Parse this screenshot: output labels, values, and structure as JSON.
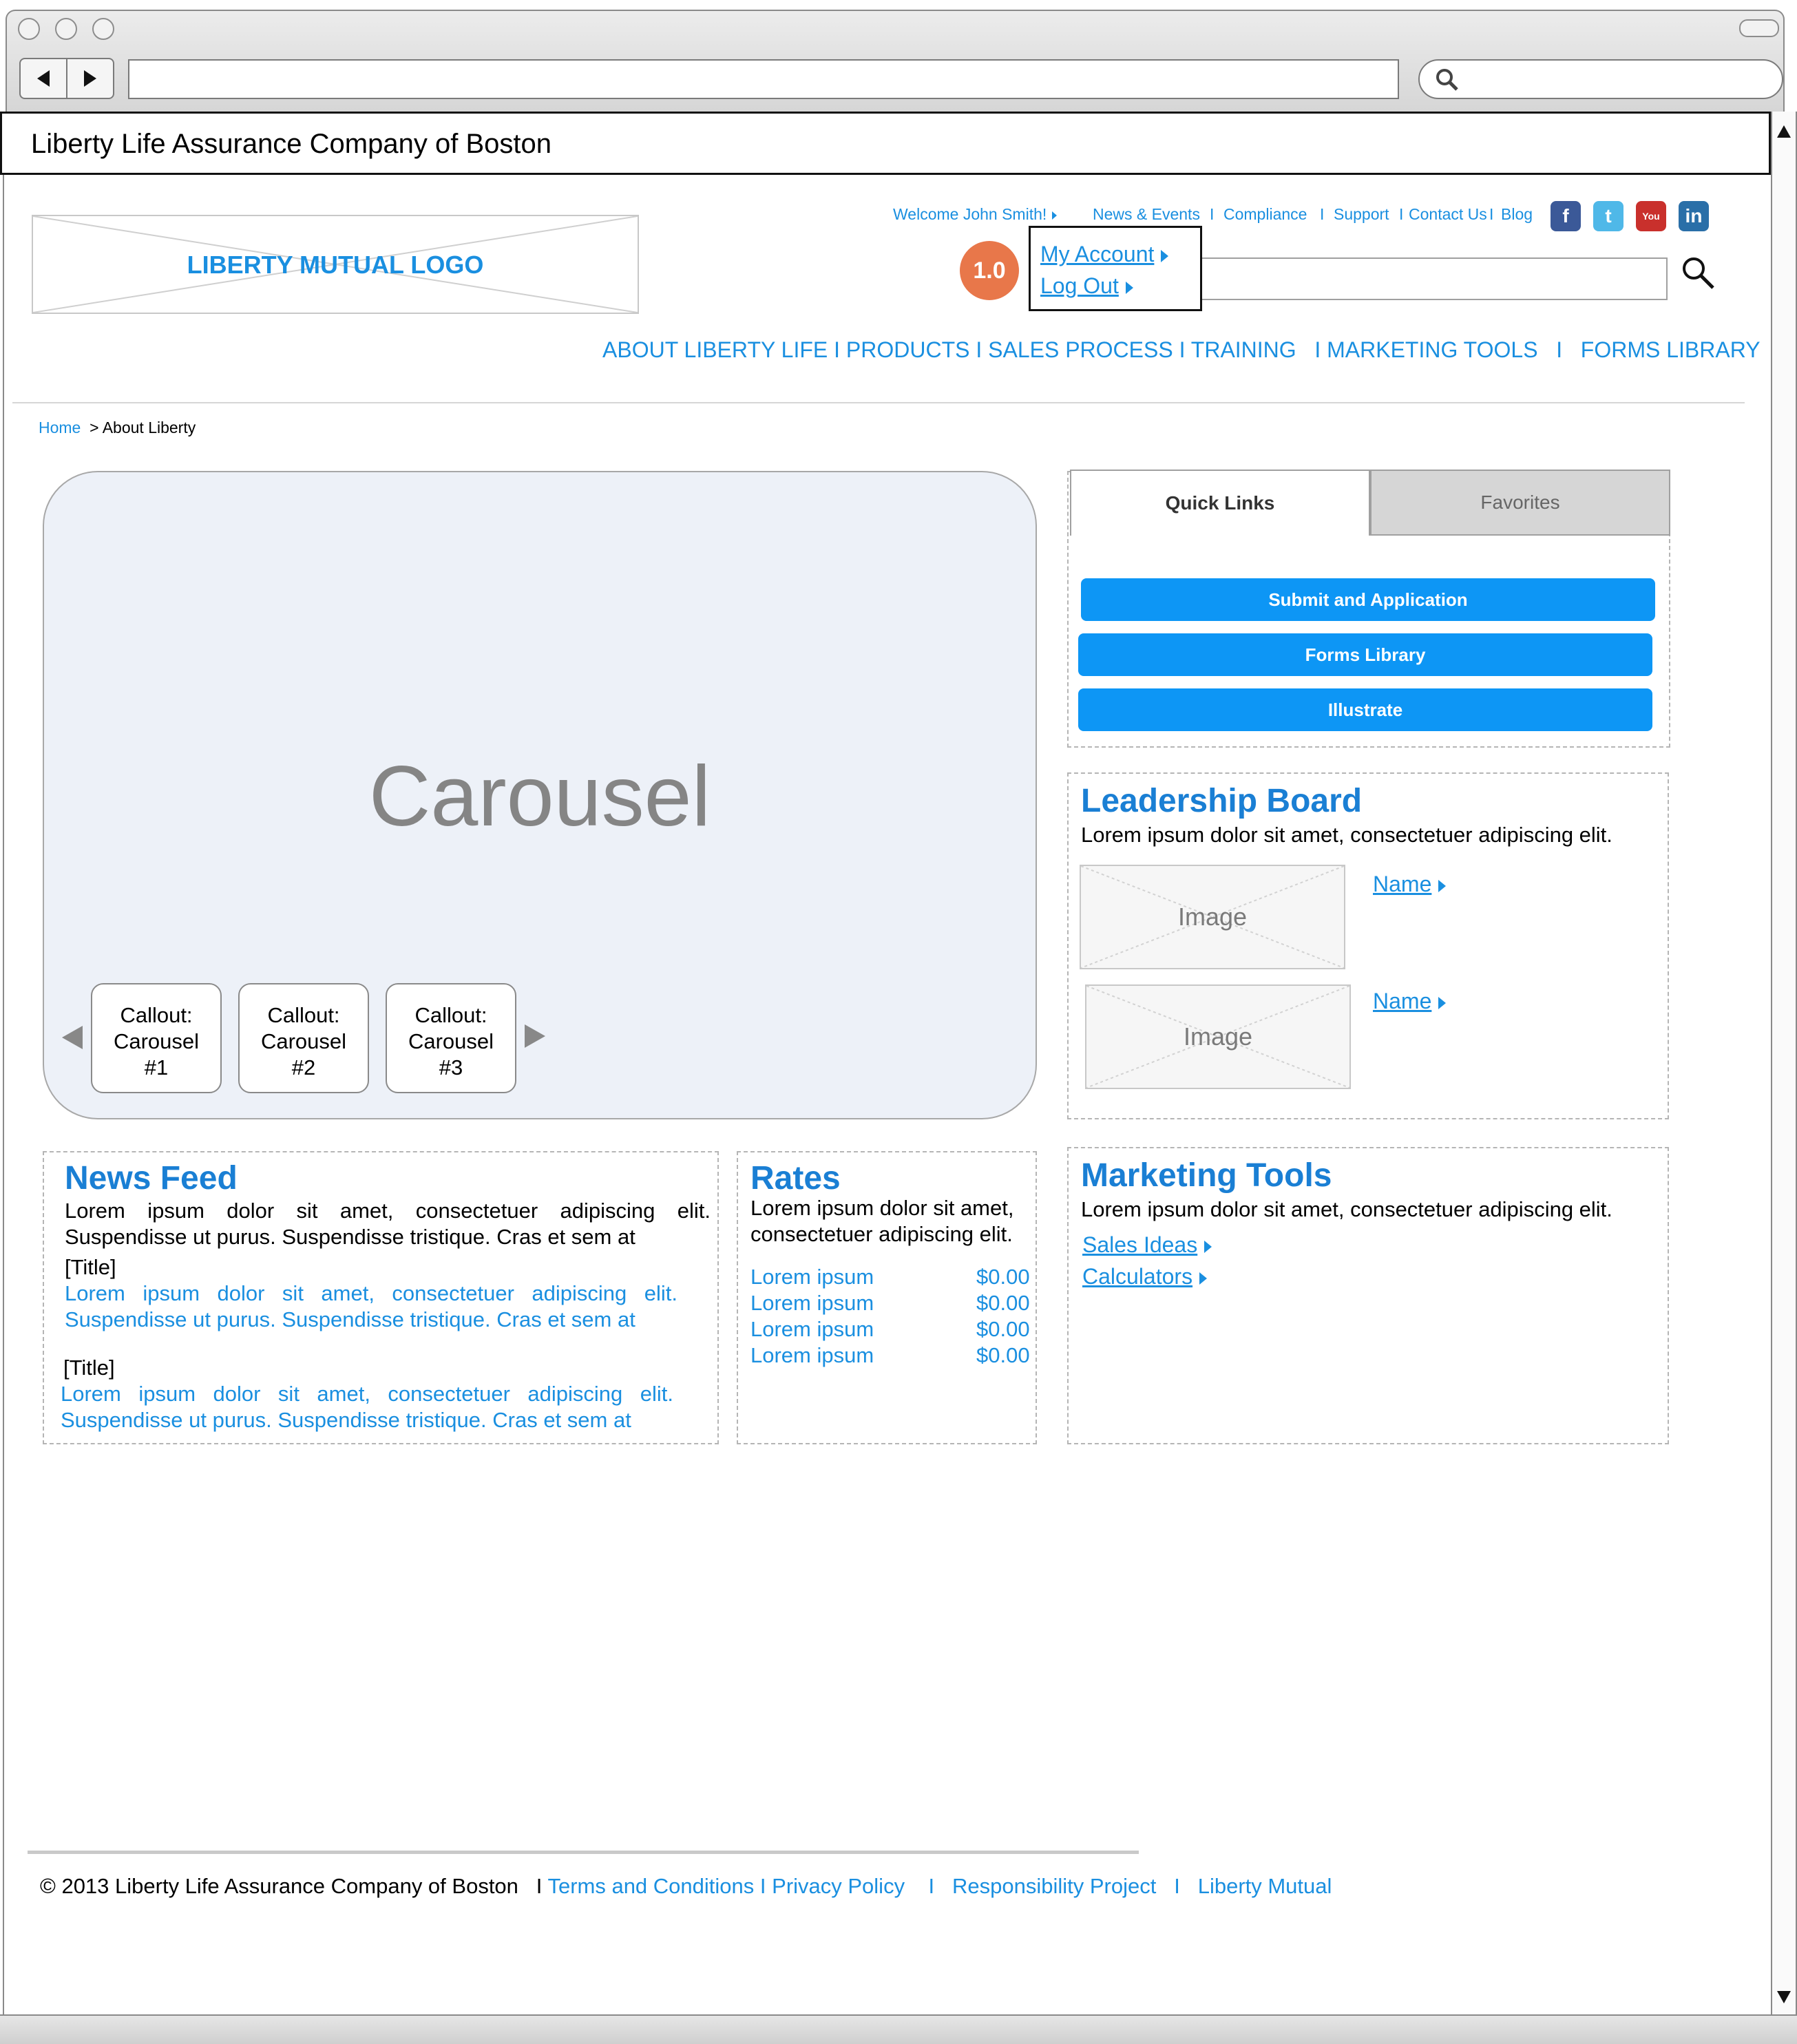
{
  "window": {
    "title": "Liberty Life Assurance Company of Boston"
  },
  "header": {
    "logo_text": "LIBERTY MUTUAL LOGO",
    "welcome": "Welcome John Smith!",
    "top_links": [
      "News & Events",
      "Compliance",
      "Support",
      "Contact Us",
      "Blog"
    ],
    "account_menu": {
      "badge": "1.0",
      "my_account": "My Account",
      "log_out": "Log Out"
    },
    "social": {
      "facebook": "f",
      "twitter": "t",
      "youtube": "You",
      "linkedin": "in"
    }
  },
  "main_nav": [
    "ABOUT LIBERTY LIFE",
    "PRODUCTS",
    "SALES PROCESS",
    "TRAINING",
    "MARKETING TOOLS",
    "FORMS LIBRARY"
  ],
  "breadcrumb": {
    "home": "Home",
    "current": "> About Liberty"
  },
  "carousel": {
    "label": "Carousel",
    "callouts": [
      {
        "line1": "Callout:",
        "line2": "Carousel",
        "line3": "#1"
      },
      {
        "line1": "Callout:",
        "line2": "Carousel",
        "line3": "#2"
      },
      {
        "line1": "Callout:",
        "line2": "Carousel",
        "line3": "#3"
      }
    ]
  },
  "quick_links": {
    "tabs": [
      "Quick Links",
      "Favorites"
    ],
    "buttons": [
      "Submit and Application",
      "Forms Library",
      "Illustrate"
    ]
  },
  "leadership": {
    "title": "Leadership Board",
    "desc": "Lorem ipsum dolor sit amet, consectetuer adipiscing elit.",
    "people": [
      {
        "image": "Image",
        "name": "Name"
      },
      {
        "image": "Image",
        "name": "Name"
      }
    ]
  },
  "news": {
    "title": "News Feed",
    "intro_l1": "Lorem ipsum dolor sit amet, consectetuer adipiscing elit.",
    "intro_l2": "Suspendisse ut purus. Suspendisse tristique. Cras et sem at",
    "items": [
      {
        "title": "[Title]",
        "l1": "Lorem ipsum dolor sit amet, consectetuer adipiscing elit.",
        "l2": "Suspendisse ut purus. Suspendisse tristique. Cras et sem at"
      },
      {
        "title": "[Title]",
        "l1": "Lorem ipsum dolor sit amet, consectetuer adipiscing elit.",
        "l2": "Suspendisse ut purus. Suspendisse tristique. Cras et sem at"
      }
    ]
  },
  "rates": {
    "title": "Rates",
    "desc_l1": "Lorem ipsum dolor sit amet,",
    "desc_l2": "consectetuer adipiscing elit.",
    "rows": [
      {
        "label": "Lorem ipsum",
        "value": "$0.00"
      },
      {
        "label": "Lorem ipsum",
        "value": "$0.00"
      },
      {
        "label": "Lorem ipsum",
        "value": "$0.00"
      },
      {
        "label": "Lorem ipsum",
        "value": "$0.00"
      }
    ]
  },
  "marketing": {
    "title": "Marketing Tools",
    "desc": "Lorem ipsum dolor sit amet, consectetuer adipiscing elit.",
    "links": [
      "Sales Ideas",
      "Calculators"
    ]
  },
  "footer": {
    "copyright": "© 2013 Liberty Life Assurance Company of Boston",
    "links": [
      "Terms and Conditions",
      "Privacy Policy",
      "Responsibility Project",
      "Liberty Mutual"
    ]
  },
  "colors": {
    "link": "#1a8fe0",
    "heading": "#1a7fd4",
    "button": "#0d96f5",
    "badge": "#e8774a"
  }
}
